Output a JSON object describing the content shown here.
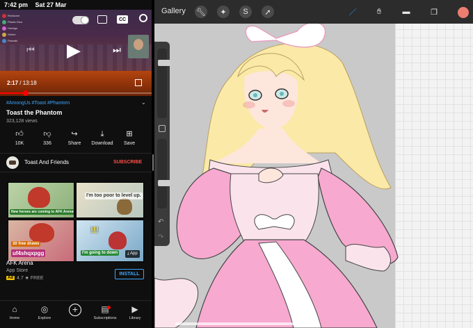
{
  "status": {
    "time": "7:42 pm",
    "date": "Sat 27 Mar"
  },
  "youtube": {
    "player": {
      "current_time": "2:17",
      "time_separator": " / ",
      "duration": "13:18",
      "progress": 0.172,
      "cc_label": "CC",
      "chat_names": [
        "Redstorm",
        "Plastic Dino",
        "Humiga",
        "Sdrein",
        "Pancaki"
      ]
    },
    "video": {
      "hashtags": "#AmongUs #Toast #Phantom",
      "title": "Toast the Phantom",
      "views": "323,128 views"
    },
    "actions": [
      {
        "icon": "thumbs-up-icon",
        "label": "10K"
      },
      {
        "icon": "thumbs-down-icon",
        "label": "336"
      },
      {
        "icon": "share-icon",
        "label": "Share"
      },
      {
        "icon": "download-icon",
        "label": "Download"
      },
      {
        "icon": "save-icon",
        "label": "Save"
      }
    ],
    "channel": {
      "name": "Toast And Friends",
      "subscribe_label": "SUBSCRIBE"
    },
    "ad": {
      "captions": [
        "New heroes are coming to AFK Arena!",
        "I'm too poor to level up.",
        "30 free draws",
        "uf4shqxpgg",
        "!!!",
        "I'm going to down"
      ],
      "app_button": "⤓ App",
      "name": "AFK Arena",
      "store": "App Store",
      "badge": "Ad",
      "rating": "4.7 ★ FREE",
      "install_label": "INSTALL"
    },
    "nav": [
      {
        "icon": "home-icon",
        "label": "Home"
      },
      {
        "icon": "explore-icon",
        "label": "Explore"
      },
      {
        "icon": "create-icon",
        "label": ""
      },
      {
        "icon": "subscriptions-icon",
        "label": "Subscriptions"
      },
      {
        "icon": "library-icon",
        "label": "Library"
      }
    ]
  },
  "procreate": {
    "gallery_label": "Gallery",
    "active_tool": "brush",
    "current_color": "#ec7e70",
    "brush_size": 0.82,
    "brush_opacity": 0.35
  }
}
